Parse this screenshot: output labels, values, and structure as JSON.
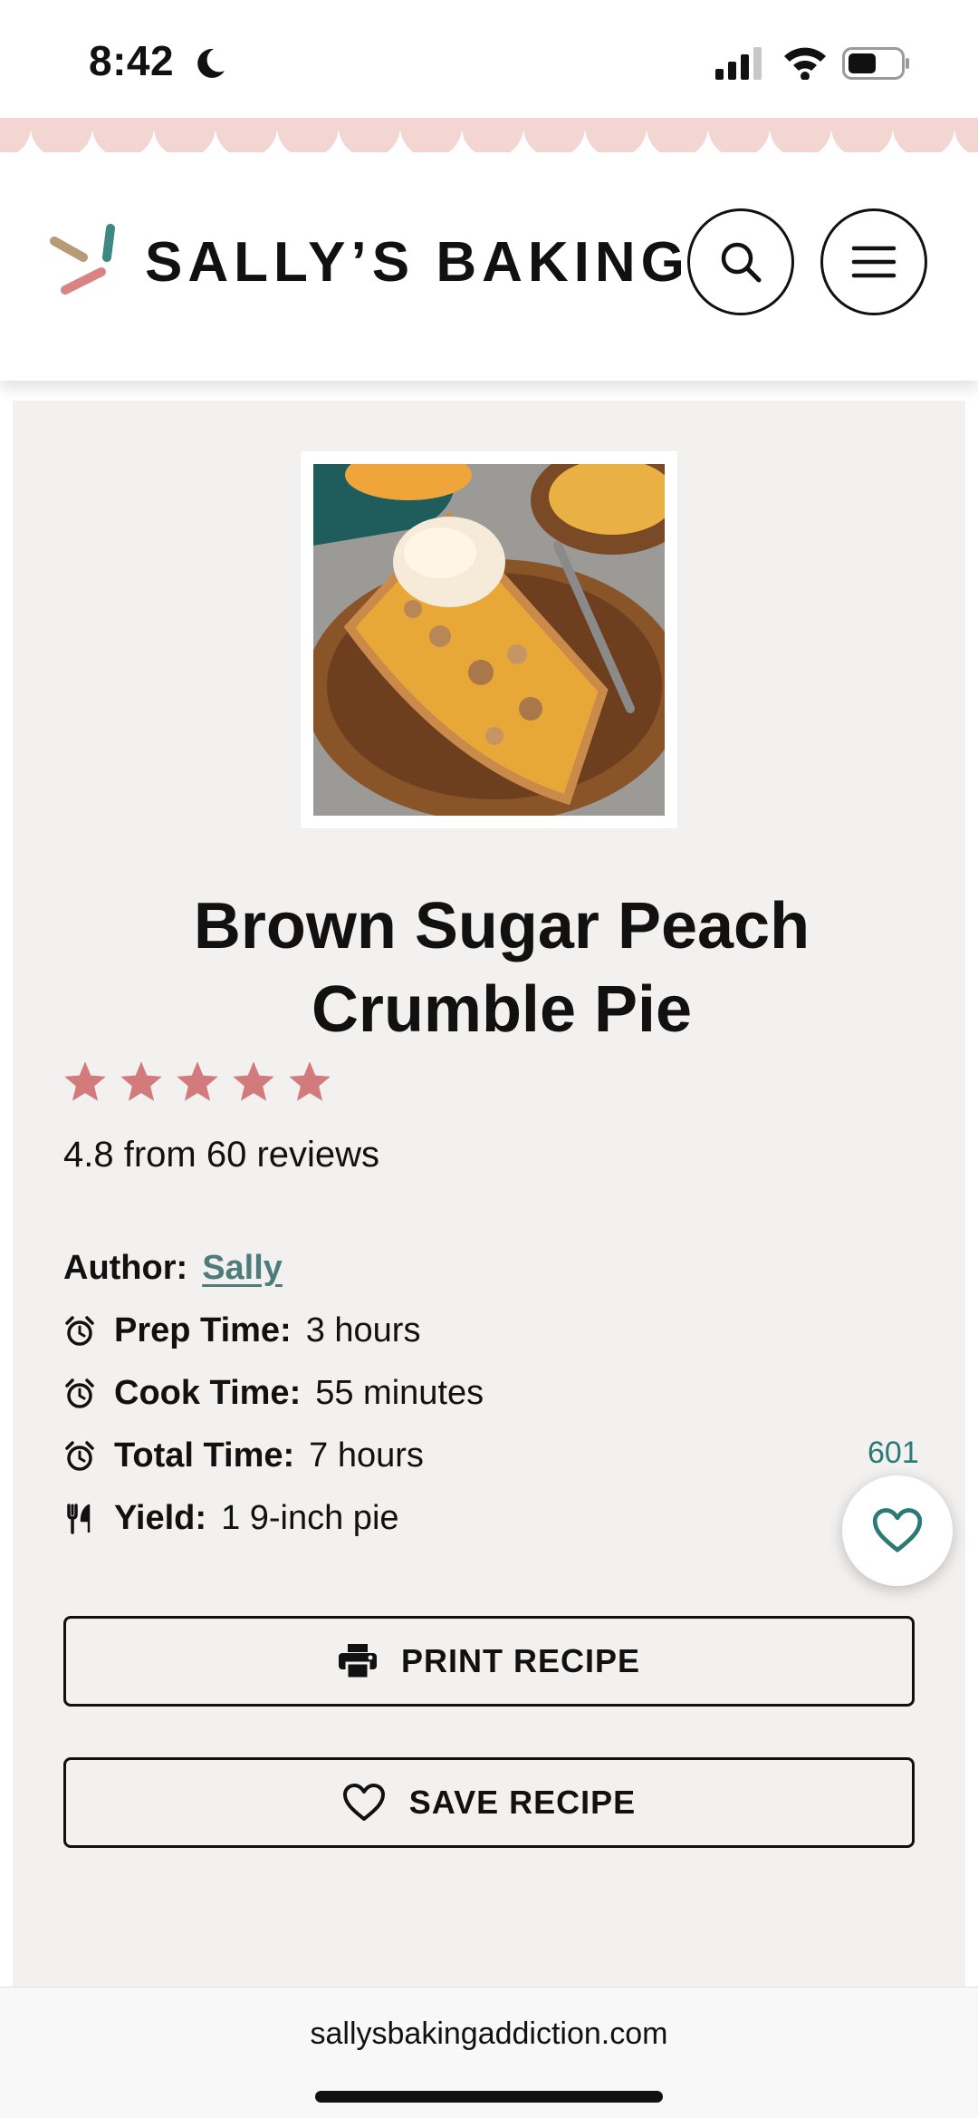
{
  "status_bar": {
    "time": "8:42",
    "icons": [
      "moon-icon",
      "signal-icon",
      "wifi-icon",
      "battery-icon"
    ]
  },
  "header": {
    "logo_text": "SALLY’S BAKING",
    "search_icon": "search-icon",
    "menu_icon": "hamburger-menu-icon"
  },
  "recipe": {
    "title": "Brown Sugar Peach Crumble Pie",
    "rating_value": 4.8,
    "stars": 5,
    "rating_text": "4.8 from 60 reviews",
    "author_label": "Author:",
    "author_name": "Sally",
    "prep_label": "Prep Time:",
    "prep_value": "3 hours",
    "cook_label": "Cook Time:",
    "cook_value": "55 minutes",
    "total_label": "Total Time:",
    "total_value": "7 hours",
    "yield_label": "Yield:",
    "yield_value": "1 9-inch pie",
    "print_label": "PRINT RECIPE",
    "save_label": "SAVE RECIPE"
  },
  "favorite": {
    "count": "601"
  },
  "browser": {
    "url": "sallysbakingaddiction.com"
  },
  "colors": {
    "scallop": "#f3d6d2",
    "star": "#d27a7c",
    "author_link": "#4e7c7a",
    "favorite": "#2c7a78",
    "card_bg": "#f2f1f0"
  }
}
